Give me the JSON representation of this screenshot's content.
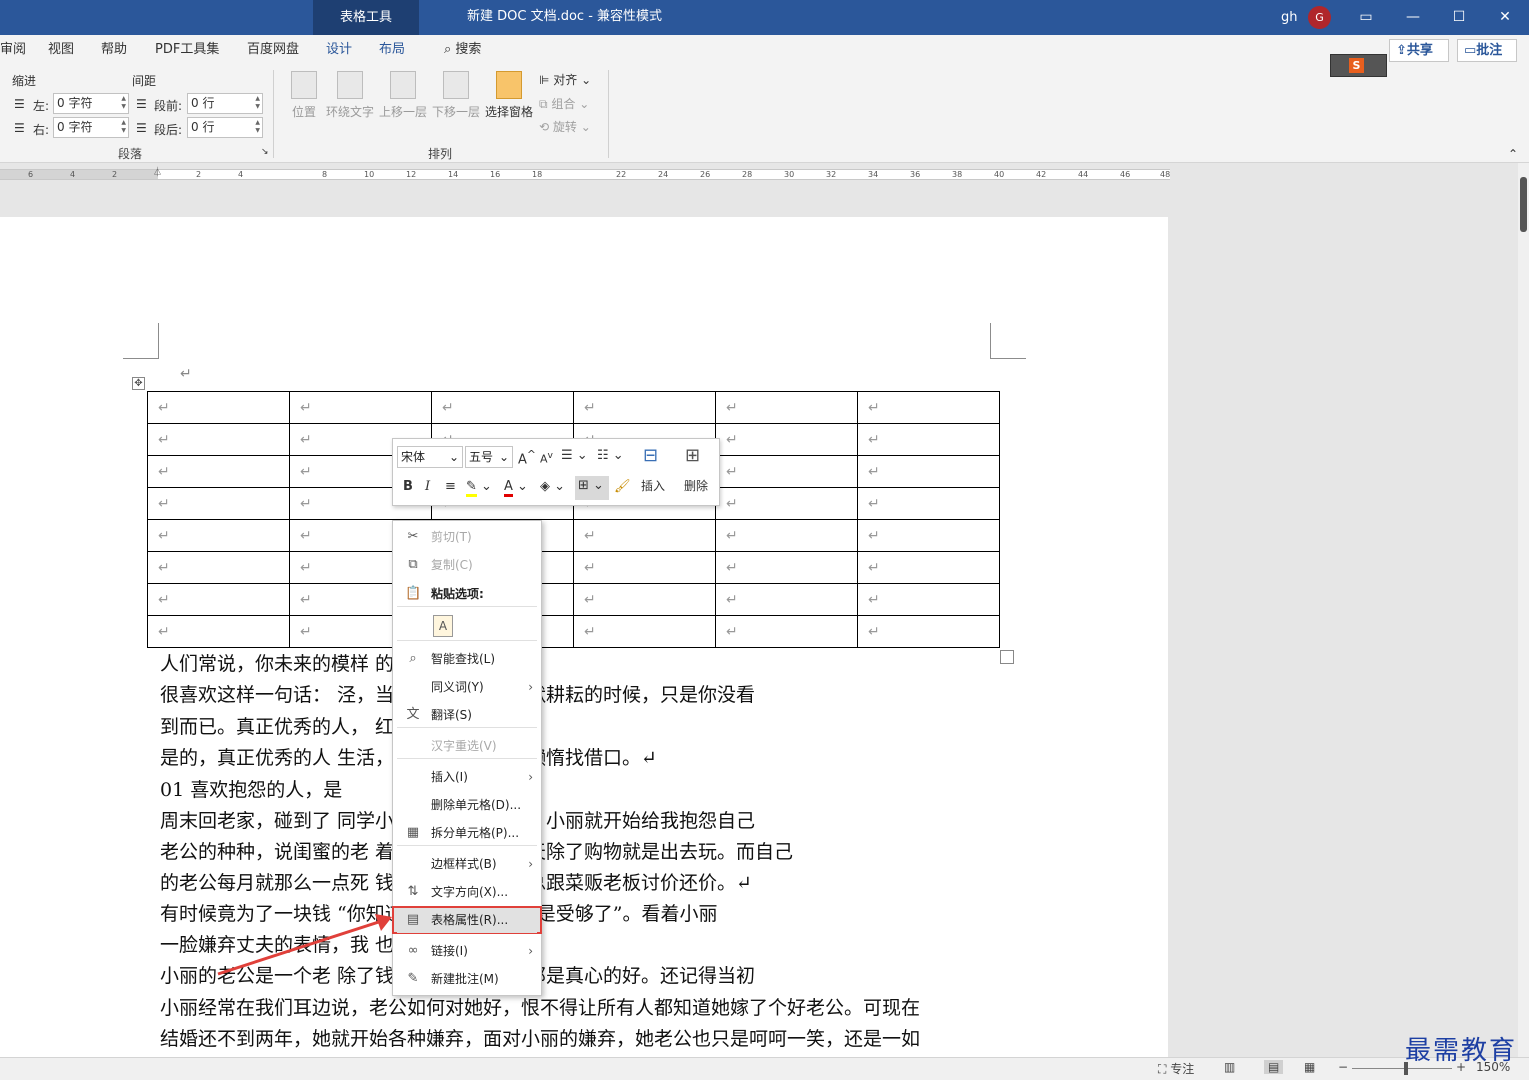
{
  "titlebar": {
    "tool_tab": "表格工具",
    "doc_title": "新建 DOC 文档.doc  -  兼容性模式",
    "user": "gh",
    "avatar_letter": "G",
    "ribbon_display_icon": "ribbon-display-icon",
    "minimize_icon": "minimize-icon",
    "maximize_icon": "maximize-icon",
    "close_icon": "close-icon"
  },
  "menu": {
    "items": [
      "审阅",
      "视图",
      "帮助",
      "PDF工具集",
      "百度网盘",
      "设计",
      "布局"
    ],
    "active": [
      "设计",
      "布局"
    ],
    "search": "搜索",
    "share": "共享",
    "comment": "批注"
  },
  "ribbon": {
    "indent_label": "缩进",
    "spacing_label": "间距",
    "left_label": "左:",
    "right_label": "右:",
    "before_label": "段前:",
    "after_label": "段后:",
    "left_value": "0 字符",
    "right_value": "0 字符",
    "before_value": "0 行",
    "after_value": "0 行",
    "paragraph_group": "段落",
    "arrange_group": "排列",
    "position": "位置",
    "wrap_text": "环绕文字",
    "bring_forward": "上移一层",
    "send_backward": "下移一层",
    "selection_pane": "选择窗格",
    "align": "对齐",
    "group": "组合",
    "rotate": "旋转"
  },
  "ruler": {
    "ticks": [
      "6",
      "4",
      "2",
      "2",
      "4",
      "8",
      "10",
      "12",
      "14",
      "16",
      "18",
      "22",
      "24",
      "26",
      "28",
      "30",
      "32",
      "34",
      "36",
      "38",
      "40",
      "42",
      "44",
      "46",
      "48"
    ]
  },
  "document": {
    "para_mark": "↵",
    "table_rows": 8,
    "table_cols": 6,
    "lines": [
      "人们常说，你未来的模样                              的努力里。↵",
      "    很喜欢这样一句话：                              泾，当别人为了梦想默默耕耘的时候，只是你没看",
      "到而已。真正优秀的人，                              红。↵",
      "    是的，真正优秀的人                              生活，也不会为自己的懒惰找借口。↵",
      "    01  喜欢抱怨的人，是",
      "    周末回老家，碰到了                              同学小丽，没说两句话，小丽就开始给我抱怨自己",
      "老公的种种，说闺蜜的老                              着大房子，闺蜜每天除了购物就是出去玩。而自己",
      "的老公每月就那么一点死                              钱，买菜的时候还总跟菜贩老板讨价还价。↵",
      "    有时候竟为了一块钱                              “你知道吗？阿心，我真是受够了”。看着小丽",
      "一脸嫌弃丈夫的表情，我                              也没说。↵",
      "    小丽的老公是一个老                              除了钱挣的少，对小丽那是真心的好。还记得当初",
      "小丽经常在我们耳边说，老公如何对她好，恨不得让所有人都知道她嫁了个好老公。可现在",
      "结婚还不到两年，她就开始各种嫌弃，面对小丽的嫌弃，她老公也只是呵呵一笑，还是一如"
    ]
  },
  "mini_toolbar": {
    "font": "宋体",
    "size": "五号",
    "grow": "A",
    "shrink": "A",
    "bold": "B",
    "italic": "I",
    "insert": "插入",
    "delete": "删除"
  },
  "context_menu": {
    "items": [
      {
        "label": "剪切(T)",
        "icon": "scissors-icon",
        "glyph": "✂",
        "disabled": true,
        "sub": false
      },
      {
        "label": "复制(C)",
        "icon": "copy-icon",
        "glyph": "⧉",
        "disabled": true,
        "sub": false
      },
      {
        "label": "粘贴选项:",
        "icon": "paste-icon",
        "glyph": "📋",
        "disabled": false,
        "sub": false
      },
      {
        "label": "智能查找(L)",
        "icon": "smart-lookup-icon",
        "glyph": "⌕",
        "disabled": false,
        "sub": false
      },
      {
        "label": "同义词(Y)",
        "icon": "",
        "glyph": "",
        "disabled": false,
        "sub": true
      },
      {
        "label": "翻译(S)",
        "icon": "translate-icon",
        "glyph": "文",
        "disabled": false,
        "sub": false
      },
      {
        "label": "汉字重选(V)",
        "icon": "",
        "glyph": "",
        "disabled": true,
        "sub": false
      },
      {
        "label": "插入(I)",
        "icon": "",
        "glyph": "",
        "disabled": false,
        "sub": true
      },
      {
        "label": "删除单元格(D)...",
        "icon": "",
        "glyph": "",
        "disabled": false,
        "sub": false
      },
      {
        "label": "拆分单元格(P)...",
        "icon": "split-cells-icon",
        "glyph": "▦",
        "disabled": false,
        "sub": false
      },
      {
        "label": "边框样式(B)",
        "icon": "",
        "glyph": "",
        "disabled": false,
        "sub": true
      },
      {
        "label": "文字方向(X)...",
        "icon": "text-direction-icon",
        "glyph": "⇅",
        "disabled": false,
        "sub": false
      },
      {
        "label": "表格属性(R)...",
        "icon": "table-properties-icon",
        "glyph": "▤",
        "disabled": false,
        "sub": false
      },
      {
        "label": "链接(I)",
        "icon": "link-icon",
        "glyph": "∞",
        "disabled": false,
        "sub": true
      },
      {
        "label": "新建批注(M)",
        "icon": "new-comment-icon",
        "glyph": "✎",
        "disabled": false,
        "sub": false
      }
    ],
    "highlight_color": "#e0403a"
  },
  "statusbar": {
    "focus": "专注",
    "zoom": "150%",
    "minus": "−",
    "plus": "+"
  },
  "watermark": "最需教育",
  "colors": {
    "title_bar": "#2b579a",
    "arrow": "#e0403a"
  }
}
